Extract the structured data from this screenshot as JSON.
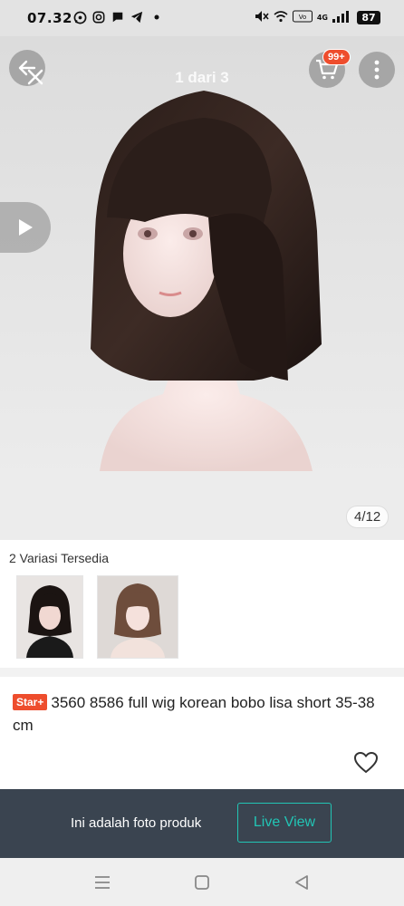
{
  "status_bar": {
    "time": "07.32",
    "network_label": "4G",
    "battery": "87",
    "icons": [
      "whatsapp-icon",
      "instagram-icon",
      "message-icon",
      "telegram-icon",
      "dot-icon",
      "mute-icon",
      "wifi-icon",
      "volte-icon",
      "signal-icon",
      "battery-icon"
    ]
  },
  "gallery": {
    "pager_text": "1 dari 3",
    "cart_badge": "99+",
    "image_counter": "4/12"
  },
  "variations": {
    "title": "2 Variasi Tersedia",
    "items": [
      {
        "name": "variation-black-wig"
      },
      {
        "name": "variation-brown-wig"
      }
    ]
  },
  "product": {
    "badge": "Star+",
    "title": "3560 8586 full wig korean bobo lisa short 35-38 cm"
  },
  "banner": {
    "text": "Ini adalah foto produk",
    "button_label": "Live View"
  },
  "colors": {
    "accent": "#ee4d2d",
    "teal": "#22c5b5",
    "banner_bg": "#3a4450"
  }
}
